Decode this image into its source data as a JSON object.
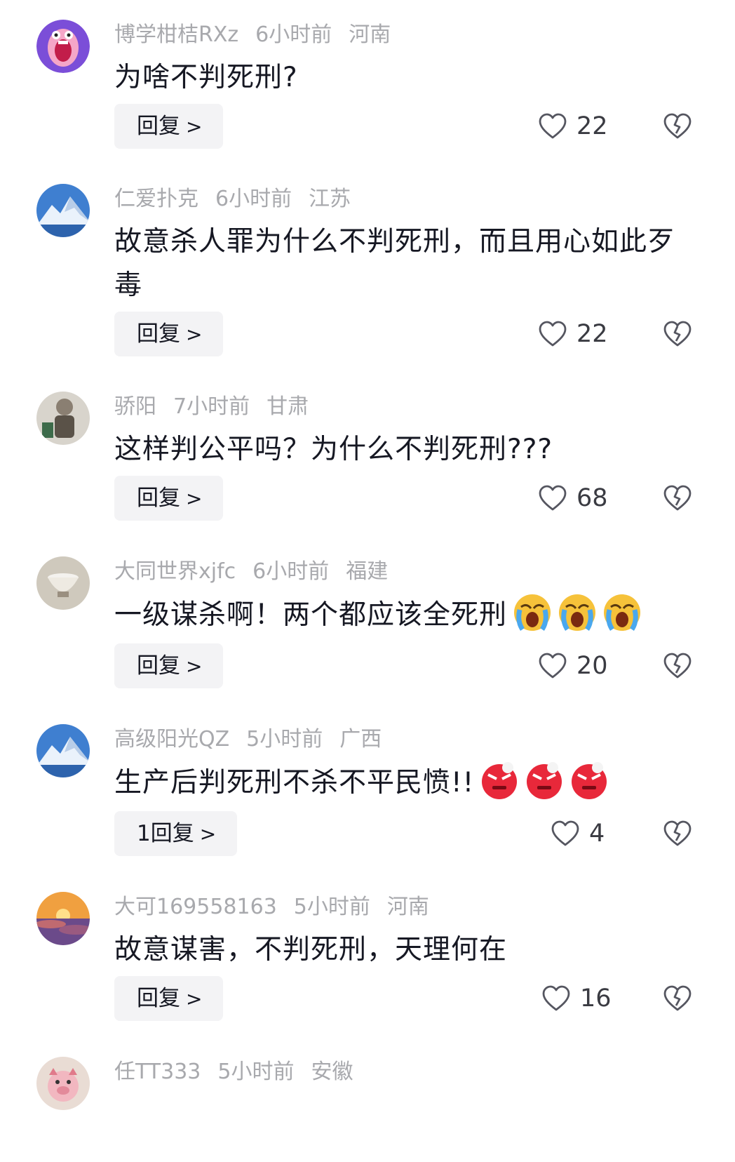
{
  "comments": [
    {
      "username": "博学柑桔RXz",
      "time": "6小时前",
      "location": "河南",
      "text": "为啥不判死刑?",
      "emojis": [],
      "reply_label": "回复",
      "likes": "22",
      "avatar": "screaming-face-icon"
    },
    {
      "username": "仁爱扑克",
      "time": "6小时前",
      "location": "江苏",
      "text": "故意杀人罪为什么不判死刑，而且用心如此歹毒",
      "emojis": [],
      "reply_label": "回复",
      "likes": "22",
      "avatar": "snow-mountain-icon"
    },
    {
      "username": "骄阳",
      "time": "7小时前",
      "location": "甘肃",
      "text": "这样判公平吗？为什么不判死刑???",
      "emojis": [],
      "reply_label": "回复",
      "likes": "68",
      "avatar": "figurine-photo-icon"
    },
    {
      "username": "大同世界xjfc",
      "time": "6小时前",
      "location": "福建",
      "text": "一级谋杀啊！两个都应该全死刑",
      "emojis": [
        "crying-emoji",
        "crying-emoji",
        "crying-emoji"
      ],
      "reply_label": "回复",
      "likes": "20",
      "avatar": "teacup-photo-icon"
    },
    {
      "username": "高级阳光QZ",
      "time": "5小时前",
      "location": "广西",
      "text": "生产后判死刑不杀不平民愤!!",
      "emojis": [
        "angry-emoji",
        "angry-emoji",
        "angry-emoji"
      ],
      "reply_label": "1回复",
      "likes": "4",
      "avatar": "snow-mountain-icon"
    },
    {
      "username": "大可169558163",
      "time": "5小时前",
      "location": "河南",
      "text": "故意谋害，不判死刑，天理何在",
      "emojis": [],
      "reply_label": "回复",
      "likes": "16",
      "avatar": "sunset-clouds-icon"
    },
    {
      "username": "任TT333",
      "time": "5小时前",
      "location": "安徽",
      "text": "",
      "emojis": [],
      "reply_label": "",
      "likes": "",
      "avatar": "pig-doll-icon"
    }
  ],
  "colors": {
    "meta": "#a8a9ad",
    "text": "#161823",
    "reply_bg": "#f3f3f5",
    "icon": "#555660"
  }
}
